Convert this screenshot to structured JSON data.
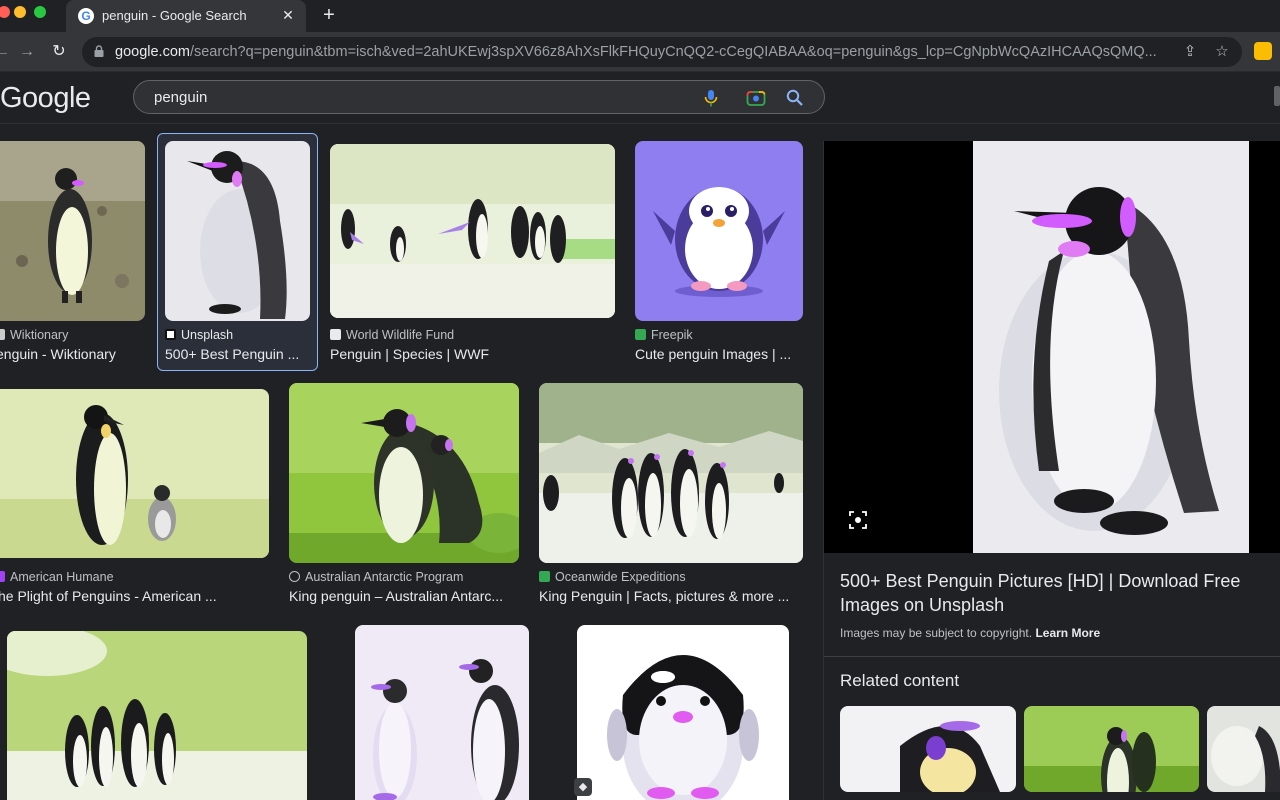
{
  "browser": {
    "tab_title": "penguin - Google Search",
    "url_domain": "google.com",
    "url_path": "/search?q=penguin&tbm=isch&ved=2ahUKEwj3spXV66z8AhXsFlkFHQuyCnQQ2-cCegQIABAA&oq=penguin&gs_lcp=CgNpbWcQAzIHCAAQsQMQ..."
  },
  "header": {
    "logo": "Google",
    "query": "penguin"
  },
  "results": [
    {
      "source": "Wiktionary",
      "caption": "enguin - Wiktionary"
    },
    {
      "source": "Unsplash",
      "caption": "500+ Best Penguin ..."
    },
    {
      "source": "World Wildlife Fund",
      "caption": "Penguin | Species | WWF"
    },
    {
      "source": "Freepik",
      "caption": "Cute penguin Images | ..."
    },
    {
      "source": "American Humane",
      "caption": "he Plight of Penguins - American ..."
    },
    {
      "source": "Australian Antarctic Program",
      "caption": "King penguin – Australian Antarc..."
    },
    {
      "source": "Oceanwide Expeditions",
      "caption": "King Penguin | Facts, pictures & more ..."
    }
  ],
  "panel": {
    "title": "500+ Best Penguin Pictures [HD] | Download Free Images on Unsplash",
    "copyright": "Images may be subject to copyright.",
    "learn_more": "Learn More",
    "related": "Related content"
  },
  "colors": {
    "background": "#202124",
    "selected_border": "#8ab4f8",
    "accent_magenta": "#d35cff"
  }
}
